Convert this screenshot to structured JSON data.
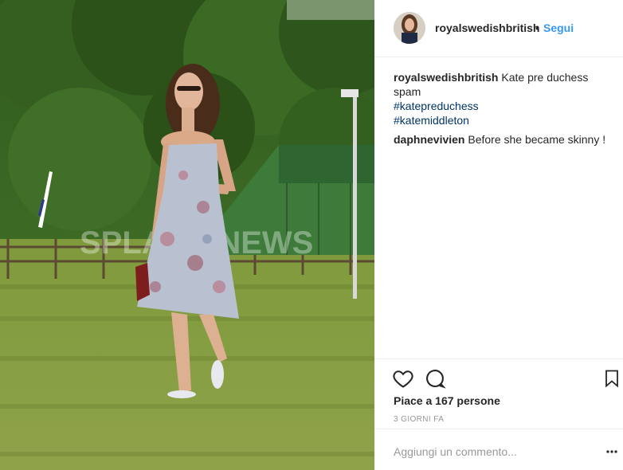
{
  "post": {
    "username": "royalswedishbritish",
    "separator": "•",
    "follow_label": "Segui"
  },
  "comments": [
    {
      "user": "royalswedishbritish",
      "text": "Kate pre duchess spam",
      "hashtags": [
        "#katepreduchess",
        "#katemiddleton"
      ]
    },
    {
      "user": "daphnevivien",
      "text": "Before she became skinny !"
    }
  ],
  "actions": {
    "like_icon": "heart-icon",
    "comment_icon": "comment-bubble-icon",
    "save_icon": "bookmark-icon"
  },
  "likes_text": "Piace a 167 persone",
  "timestamp": "3 GIORNI FA",
  "add_comment": {
    "placeholder": "Aggiungi un commento...",
    "more_icon": "more-options-icon"
  },
  "photo": {
    "watermark": "SPLASH NEWS"
  },
  "colors": {
    "link": "#3897f0",
    "hashtag": "#003569",
    "muted": "#999999",
    "border": "#efefef"
  }
}
